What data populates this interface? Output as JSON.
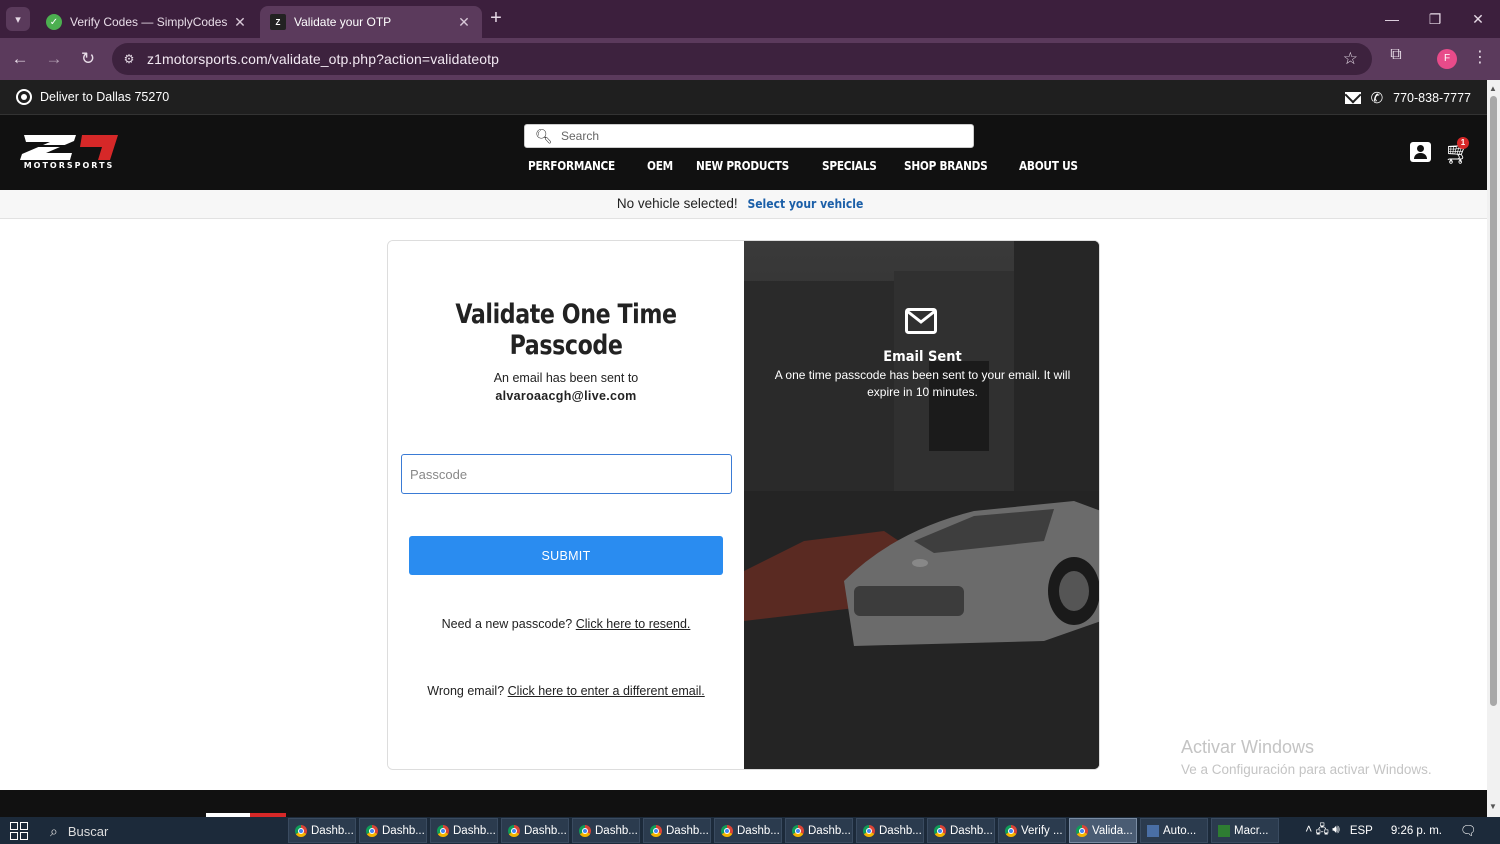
{
  "browser": {
    "tabs": [
      {
        "title": "Verify Codes — SimplyCodes",
        "active": false,
        "favicon": "simplycodes-check-icon"
      },
      {
        "title": "Validate your OTP",
        "active": true,
        "favicon": "z1-logo-icon"
      }
    ],
    "url": "z1motorsports.com/validate_otp.php?action=validateotp",
    "profile_initial": "F"
  },
  "topbar": {
    "deliver_text": "Deliver to Dallas 75270",
    "phone": "770-838-7777"
  },
  "header": {
    "logo_text": "MOTORSPORTS",
    "search_placeholder": "Search",
    "nav": [
      "PERFORMANCE",
      "OEM",
      "NEW PRODUCTS",
      "SPECIALS",
      "SHOP BRANDS",
      "ABOUT US"
    ],
    "cart_count": "1"
  },
  "vehicle_bar": {
    "text": "No vehicle selected!",
    "link": "Select your vehicle"
  },
  "otp": {
    "title": "Validate One Time Passcode",
    "sent_to_label": "An email has been sent to",
    "email": "alvaroaacgh@live.com",
    "passcode_placeholder": "Passcode",
    "submit_label": "SUBMIT",
    "resend_prompt": "Need a new passcode?",
    "resend_link": "Click here to resend.",
    "wrong_email_prompt": "Wrong email?",
    "wrong_email_link": "Click here to enter a different email."
  },
  "side_panel": {
    "heading": "Email Sent",
    "message": "A one time passcode has been sent to your email. It will expire in 10 minutes."
  },
  "watermark": {
    "line1": "Activar Windows",
    "line2": "Ve a Configuración para activar Windows."
  },
  "taskbar": {
    "search_label": "Buscar",
    "apps": [
      {
        "label": "Dashb...",
        "icon": "chrome-icon",
        "active": false
      },
      {
        "label": "Dashb...",
        "icon": "chrome-icon",
        "active": false
      },
      {
        "label": "Dashb...",
        "icon": "chrome-icon",
        "active": false
      },
      {
        "label": "Dashb...",
        "icon": "chrome-icon",
        "active": false
      },
      {
        "label": "Dashb...",
        "icon": "chrome-icon",
        "active": false
      },
      {
        "label": "Dashb...",
        "icon": "chrome-icon",
        "active": false
      },
      {
        "label": "Dashb...",
        "icon": "chrome-icon",
        "active": false
      },
      {
        "label": "Dashb...",
        "icon": "chrome-icon",
        "active": false
      },
      {
        "label": "Dashb...",
        "icon": "chrome-icon",
        "active": false
      },
      {
        "label": "Dashb...",
        "icon": "chrome-icon",
        "active": false
      },
      {
        "label": "Verify ...",
        "icon": "chrome-icon",
        "active": false
      },
      {
        "label": "Valida...",
        "icon": "chrome-icon",
        "active": true
      },
      {
        "label": "Auto...",
        "icon": "autohotkey-icon",
        "active": false
      },
      {
        "label": "Macr...",
        "icon": "macro-app-icon",
        "active": false
      }
    ],
    "language": "ESP",
    "time": "9:26 p. m."
  },
  "colors": {
    "tab_bar": "#3c1f3d",
    "address_bar": "#5b3a5c",
    "site_header": "#111111",
    "submit_button": "#2a8cf0",
    "link_blue": "#1b5fa8",
    "cart_badge": "#d62828"
  }
}
